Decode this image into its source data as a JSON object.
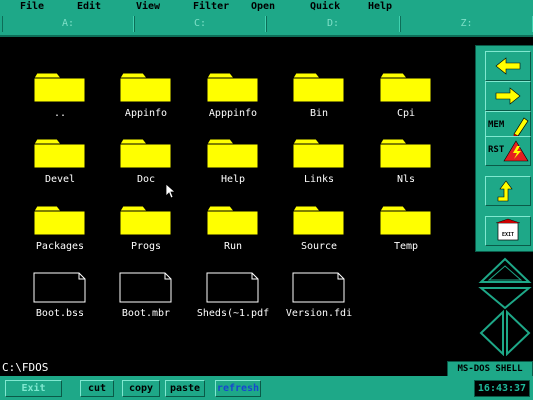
{
  "menu": [
    "File",
    "Edit",
    "View",
    "Filter",
    "Open",
    "Quick",
    "Help"
  ],
  "drives": [
    "A:",
    "C:",
    "D:",
    "Z:"
  ],
  "items": [
    {
      "label": "..",
      "type": "folder"
    },
    {
      "label": "Appinfo",
      "type": "folder"
    },
    {
      "label": "Apppinfo",
      "type": "folder"
    },
    {
      "label": "Bin",
      "type": "folder"
    },
    {
      "label": "Cpi",
      "type": "folder"
    },
    {
      "label": "Devel",
      "type": "folder"
    },
    {
      "label": "Doc",
      "type": "folder"
    },
    {
      "label": "Help",
      "type": "folder"
    },
    {
      "label": "Links",
      "type": "folder"
    },
    {
      "label": "Nls",
      "type": "folder"
    },
    {
      "label": "Packages",
      "type": "folder"
    },
    {
      "label": "Progs",
      "type": "folder"
    },
    {
      "label": "Run",
      "type": "folder"
    },
    {
      "label": "Source",
      "type": "folder"
    },
    {
      "label": "Temp",
      "type": "folder"
    },
    {
      "label": "Boot.bss",
      "type": "file"
    },
    {
      "label": "Boot.mbr",
      "type": "file"
    },
    {
      "label": "Sheds(~1.pdf",
      "type": "file"
    },
    {
      "label": "Version.fdi",
      "type": "file"
    }
  ],
  "side_buttons": {
    "mem": "MEM",
    "rst": "RST",
    "exit": "EXIT"
  },
  "path": "C:\\FDOS",
  "shell_title": "MS-DOS SHELL",
  "status": {
    "exit": "Exit",
    "cut": "cut",
    "copy": "copy",
    "paste": "paste",
    "refresh": "refresh"
  },
  "clock": "16:43:37",
  "colors": {
    "panel": "#1ea888",
    "folder": "#ffff00",
    "background": "#000000"
  }
}
